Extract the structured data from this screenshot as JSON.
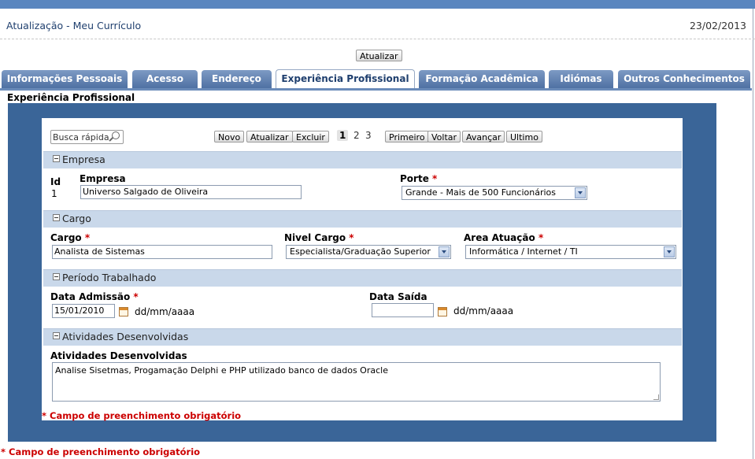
{
  "header": {
    "title": "Atualização - Meu Currículo",
    "date": "23/02/2013",
    "update_button": "Atualizar"
  },
  "tabs": [
    {
      "label": "Informações Pessoais"
    },
    {
      "label": "Acesso"
    },
    {
      "label": "Endereço"
    },
    {
      "label": "Experiência Profissional"
    },
    {
      "label": "Formação Acadêmica"
    },
    {
      "label": "Idiómas"
    },
    {
      "label": "Outros Conhecimentos"
    }
  ],
  "section_title": "Experiência Profissional",
  "toolbar": {
    "search_placeholder": "Busca rápida",
    "novo": "Novo",
    "atualizar": "Atualizar",
    "excluir": "Excluir",
    "pages": [
      "1",
      "2",
      "3"
    ],
    "primeiro": "Primeiro",
    "voltar": "Voltar",
    "avancar": "Avançar",
    "ultimo": "Ultimo"
  },
  "empresa_section": {
    "header": "Empresa",
    "id_label": "Id",
    "id_value": "1",
    "empresa_label": "Empresa",
    "empresa_value": "Universo Salgado de Oliveira",
    "porte_label": "Porte",
    "porte_value": "Grande - Mais de 500 Funcionários"
  },
  "cargo_section": {
    "header": "Cargo",
    "cargo_label": "Cargo",
    "cargo_value": "Analista de Sistemas",
    "nivel_label": "Nivel Cargo",
    "nivel_value": "Especialista/Graduação Superior",
    "area_label": "Area Atuação",
    "area_value": "Informática / Internet / TI"
  },
  "periodo_section": {
    "header": "Período Trabalhado",
    "admissao_label": "Data Admissão",
    "admissao_value": "15/01/2010",
    "admissao_format": "dd/mm/aaaa",
    "saida_label": "Data Saída",
    "saida_value": "",
    "saida_format": "dd/mm/aaaa"
  },
  "atividades_section": {
    "header": "Atividades Desenvolvidas",
    "label": "Atividades Desenvolvidas",
    "value": "Analise Sisetmas, Progamação Delphi e PHP utilizado banco de dados Oracle"
  },
  "required_marker": "*",
  "required_note": "Campo de preenchimento obrigatório",
  "colors": {
    "tab": "#5a7fb3",
    "panel": "#3a6598",
    "band": "#c9d8ea",
    "required": "#cc0000"
  }
}
